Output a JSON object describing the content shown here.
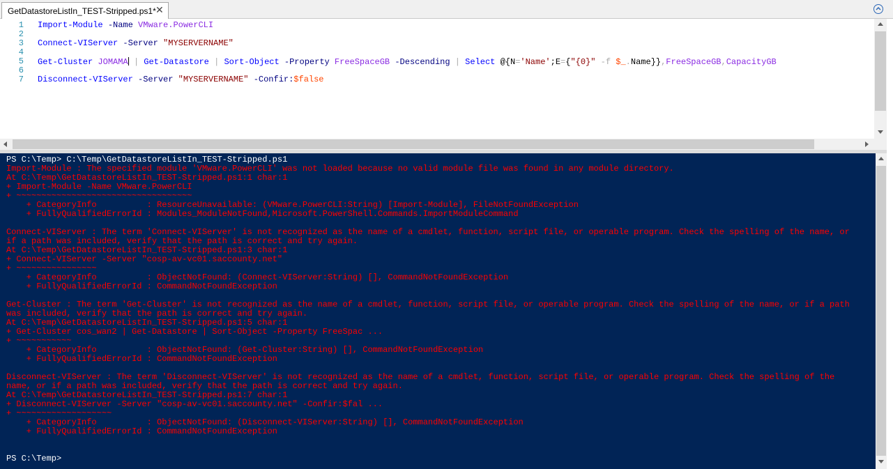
{
  "tab": {
    "title": "GetDatastoreListIn_TEST-Stripped.ps1*",
    "close_glyph": "✕"
  },
  "editor": {
    "lines": [
      {
        "num": "1",
        "tokens": [
          {
            "t": "Import-Module",
            "c": "cmd"
          },
          {
            "t": " ",
            "c": ""
          },
          {
            "t": "-Name",
            "c": "param"
          },
          {
            "t": " ",
            "c": ""
          },
          {
            "t": "VMware.PowerCLI",
            "c": "cmdarg"
          }
        ]
      },
      {
        "num": "2",
        "tokens": []
      },
      {
        "num": "3",
        "tokens": [
          {
            "t": "Connect-VIServer",
            "c": "cmd"
          },
          {
            "t": " ",
            "c": ""
          },
          {
            "t": "-Server",
            "c": "param"
          },
          {
            "t": " ",
            "c": ""
          },
          {
            "t": "\"MYSERVERNAME\"",
            "c": "str"
          }
        ]
      },
      {
        "num": "4",
        "tokens": []
      },
      {
        "num": "5",
        "tokens": [
          {
            "t": "Get-Cluster",
            "c": "cmd"
          },
          {
            "t": " ",
            "c": ""
          },
          {
            "t": "JOMAMA",
            "c": "cmdarg"
          },
          {
            "t": "CARET",
            "c": "caret"
          },
          {
            "t": " | ",
            "c": "op"
          },
          {
            "t": "Get-Datastore",
            "c": "cmd"
          },
          {
            "t": " | ",
            "c": "op"
          },
          {
            "t": "Sort-Object",
            "c": "cmd"
          },
          {
            "t": " ",
            "c": ""
          },
          {
            "t": "-Property",
            "c": "param"
          },
          {
            "t": " ",
            "c": ""
          },
          {
            "t": "FreeSpaceGB",
            "c": "cmdarg"
          },
          {
            "t": " ",
            "c": ""
          },
          {
            "t": "-Descending",
            "c": "param"
          },
          {
            "t": " | ",
            "c": "op"
          },
          {
            "t": "Select",
            "c": "cmd"
          },
          {
            "t": " ",
            "c": ""
          },
          {
            "t": "@{",
            "c": ""
          },
          {
            "t": "N",
            "c": ""
          },
          {
            "t": "=",
            "c": "op"
          },
          {
            "t": "'Name'",
            "c": "str"
          },
          {
            "t": ";",
            "c": ""
          },
          {
            "t": "E",
            "c": ""
          },
          {
            "t": "=",
            "c": "op"
          },
          {
            "t": "{",
            "c": ""
          },
          {
            "t": "\"{0}\"",
            "c": "str"
          },
          {
            "t": " ",
            "c": ""
          },
          {
            "t": "-f",
            "c": "op"
          },
          {
            "t": " ",
            "c": ""
          },
          {
            "t": "$_",
            "c": "var"
          },
          {
            "t": ".",
            "c": "op"
          },
          {
            "t": "Name",
            "c": ""
          },
          {
            "t": "}}",
            "c": ""
          },
          {
            "t": ",",
            "c": "op"
          },
          {
            "t": "FreeSpaceGB",
            "c": "cmdarg"
          },
          {
            "t": ",",
            "c": "op"
          },
          {
            "t": "CapacityGB",
            "c": "cmdarg"
          }
        ]
      },
      {
        "num": "6",
        "tokens": []
      },
      {
        "num": "7",
        "tokens": [
          {
            "t": "Disconnect-VIServer",
            "c": "cmd"
          },
          {
            "t": " ",
            "c": ""
          },
          {
            "t": "-Server",
            "c": "param"
          },
          {
            "t": " ",
            "c": ""
          },
          {
            "t": "\"MYSERVERNAME\"",
            "c": "str"
          },
          {
            "t": " ",
            "c": ""
          },
          {
            "t": "-Confir:",
            "c": "param"
          },
          {
            "t": "$false",
            "c": "var"
          }
        ]
      }
    ]
  },
  "console": {
    "lines": [
      {
        "text": "PS C:\\Temp> C:\\Temp\\GetDatastoreListIn_TEST-Stripped.ps1",
        "kind": "out"
      },
      {
        "text": "Import-Module : The specified module 'VMware.PowerCLI' was not loaded because no valid module file was found in any module directory.",
        "kind": "err"
      },
      {
        "text": "At C:\\Temp\\GetDatastoreListIn_TEST-Stripped.ps1:1 char:1",
        "kind": "err"
      },
      {
        "text": "+ Import-Module -Name VMware.PowerCLI",
        "kind": "err"
      },
      {
        "text": "+ ~~~~~~~~~~~~~~~~~~~~~~~~~~~~~~~~~~~",
        "kind": "err"
      },
      {
        "text": "    + CategoryInfo          : ResourceUnavailable: (VMware.PowerCLI:String) [Import-Module], FileNotFoundException",
        "kind": "err"
      },
      {
        "text": "    + FullyQualifiedErrorId : Modules_ModuleNotFound,Microsoft.PowerShell.Commands.ImportModuleCommand",
        "kind": "err"
      },
      {
        "text": "",
        "kind": "err"
      },
      {
        "text": "Connect-VIServer : The term 'Connect-VIServer' is not recognized as the name of a cmdlet, function, script file, or operable program. Check the spelling of the name, or",
        "kind": "err"
      },
      {
        "text": "if a path was included, verify that the path is correct and try again.",
        "kind": "err"
      },
      {
        "text": "At C:\\Temp\\GetDatastoreListIn_TEST-Stripped.ps1:3 char:1",
        "kind": "err"
      },
      {
        "text": "+ Connect-VIServer -Server \"cosp-av-vc01.saccounty.net\"",
        "kind": "err"
      },
      {
        "text": "+ ~~~~~~~~~~~~~~~~",
        "kind": "err"
      },
      {
        "text": "    + CategoryInfo          : ObjectNotFound: (Connect-VIServer:String) [], CommandNotFoundException",
        "kind": "err"
      },
      {
        "text": "    + FullyQualifiedErrorId : CommandNotFoundException",
        "kind": "err"
      },
      {
        "text": "",
        "kind": "err"
      },
      {
        "text": "Get-Cluster : The term 'Get-Cluster' is not recognized as the name of a cmdlet, function, script file, or operable program. Check the spelling of the name, or if a path",
        "kind": "err"
      },
      {
        "text": "was included, verify that the path is correct and try again.",
        "kind": "err"
      },
      {
        "text": "At C:\\Temp\\GetDatastoreListIn_TEST-Stripped.ps1:5 char:1",
        "kind": "err"
      },
      {
        "text": "+ Get-Cluster cos_wan2 | Get-Datastore | Sort-Object -Property FreeSpac ...",
        "kind": "err"
      },
      {
        "text": "+ ~~~~~~~~~~~",
        "kind": "err"
      },
      {
        "text": "    + CategoryInfo          : ObjectNotFound: (Get-Cluster:String) [], CommandNotFoundException",
        "kind": "err"
      },
      {
        "text": "    + FullyQualifiedErrorId : CommandNotFoundException",
        "kind": "err"
      },
      {
        "text": "",
        "kind": "err"
      },
      {
        "text": "Disconnect-VIServer : The term 'Disconnect-VIServer' is not recognized as the name of a cmdlet, function, script file, or operable program. Check the spelling of the",
        "kind": "err"
      },
      {
        "text": "name, or if a path was included, verify that the path is correct and try again.",
        "kind": "err"
      },
      {
        "text": "At C:\\Temp\\GetDatastoreListIn_TEST-Stripped.ps1:7 char:1",
        "kind": "err"
      },
      {
        "text": "+ Disconnect-VIServer -Server \"cosp-av-vc01.saccounty.net\" -Confir:$fal ...",
        "kind": "err"
      },
      {
        "text": "+ ~~~~~~~~~~~~~~~~~~~",
        "kind": "err"
      },
      {
        "text": "    + CategoryInfo          : ObjectNotFound: (Disconnect-VIServer:String) [], CommandNotFoundException",
        "kind": "err"
      },
      {
        "text": "    + FullyQualifiedErrorId : CommandNotFoundException",
        "kind": "err"
      },
      {
        "text": "",
        "kind": "out"
      },
      {
        "text": "",
        "kind": "out"
      },
      {
        "text": "PS C:\\Temp>",
        "kind": "out"
      }
    ]
  },
  "colors": {
    "console_bg": "#012456",
    "error_text": "#ff0000",
    "console_text": "#ffffff",
    "line_number": "#2b91af"
  }
}
